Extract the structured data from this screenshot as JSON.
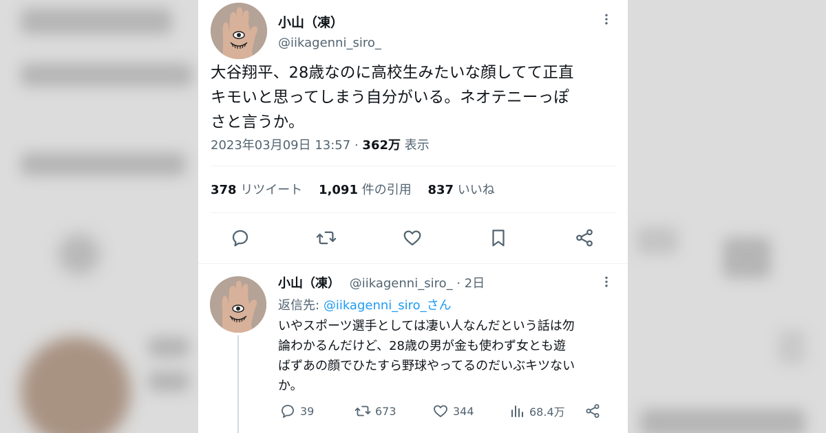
{
  "main_tweet": {
    "author_name": "小山（凍）",
    "author_handle": "@iikagenni_siro_",
    "text_line1": "大谷翔平、28歳なのに高校生みたいな顔してて正直",
    "text_line2": "キモいと思ってしまう自分がいる。ネオテニーっぽ",
    "text_line3": "さと言うか。",
    "timestamp": "2023年03月09日 13:57",
    "separator": "·",
    "views_count": "362万",
    "views_label": "表示",
    "retweets_count": "378",
    "retweets_label": "リツイート",
    "quotes_count": "1,091",
    "quotes_label": "件の引用",
    "likes_count": "837",
    "likes_label": "いいね"
  },
  "reply": {
    "author_name": "小山（凍）",
    "author_handle": "@iikagenni_siro_",
    "dot": "·",
    "time": "2日",
    "replying_label": "返信先:",
    "replying_mention": "@iikagenni_siro_さん",
    "text_line1": "いやスポーツ選手としては凄い人なんだという話は勿",
    "text_line2": "論わかるんだけど、28歳の男が金も使わず女とも遊",
    "text_line3": "ばずあの顔でひたすら野球やってるのだいぶキツない",
    "text_line4": "か。",
    "replies": "39",
    "retweets": "673",
    "likes": "344",
    "views": "68.4万"
  },
  "icons": {
    "more": "more-dots-icon",
    "reply": "reply-bubble-icon",
    "retweet": "retweet-icon",
    "like": "heart-icon",
    "bookmark": "bookmark-icon",
    "share": "share-icon",
    "views": "analytics-bars-icon"
  },
  "colors": {
    "text_primary": "#0f1419",
    "text_secondary": "#536471",
    "accent": "#1d9bf0",
    "divider": "#eff3f4"
  }
}
